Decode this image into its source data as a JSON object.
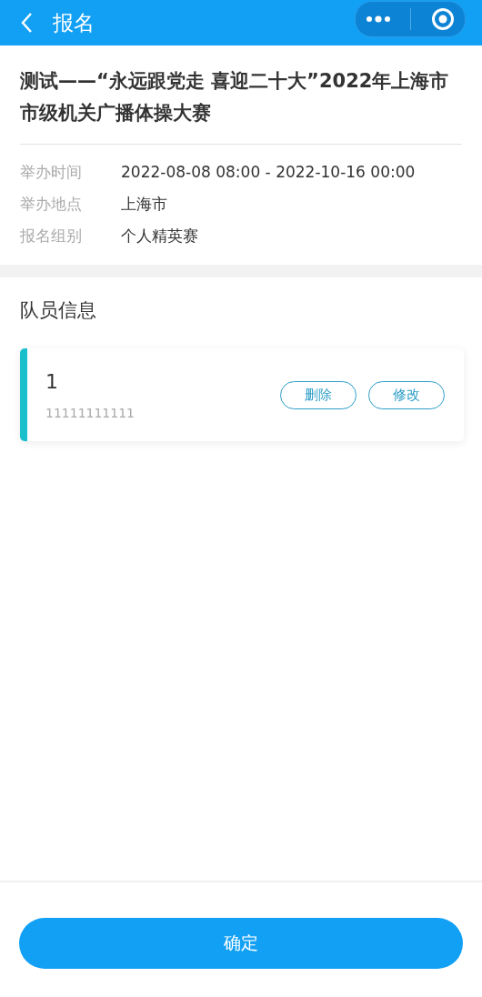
{
  "nav": {
    "title": "报名"
  },
  "event": {
    "title": "测试——“永远跟党走 喜迎二十大”2022年上海市市级机关广播体操大赛",
    "info": [
      {
        "label": "举办时间",
        "value": "2022-08-08 08:00 - 2022-10-16 00:00"
      },
      {
        "label": "举办地点",
        "value": "上海市"
      },
      {
        "label": "报名组别",
        "value": "个人精英赛"
      }
    ]
  },
  "members": {
    "title": "队员信息",
    "items": [
      {
        "name": "1",
        "phone": "11111111111",
        "color": "#1bbfcc",
        "actions": [
          "删除",
          "修改"
        ]
      }
    ]
  },
  "confirm_button": "确定"
}
